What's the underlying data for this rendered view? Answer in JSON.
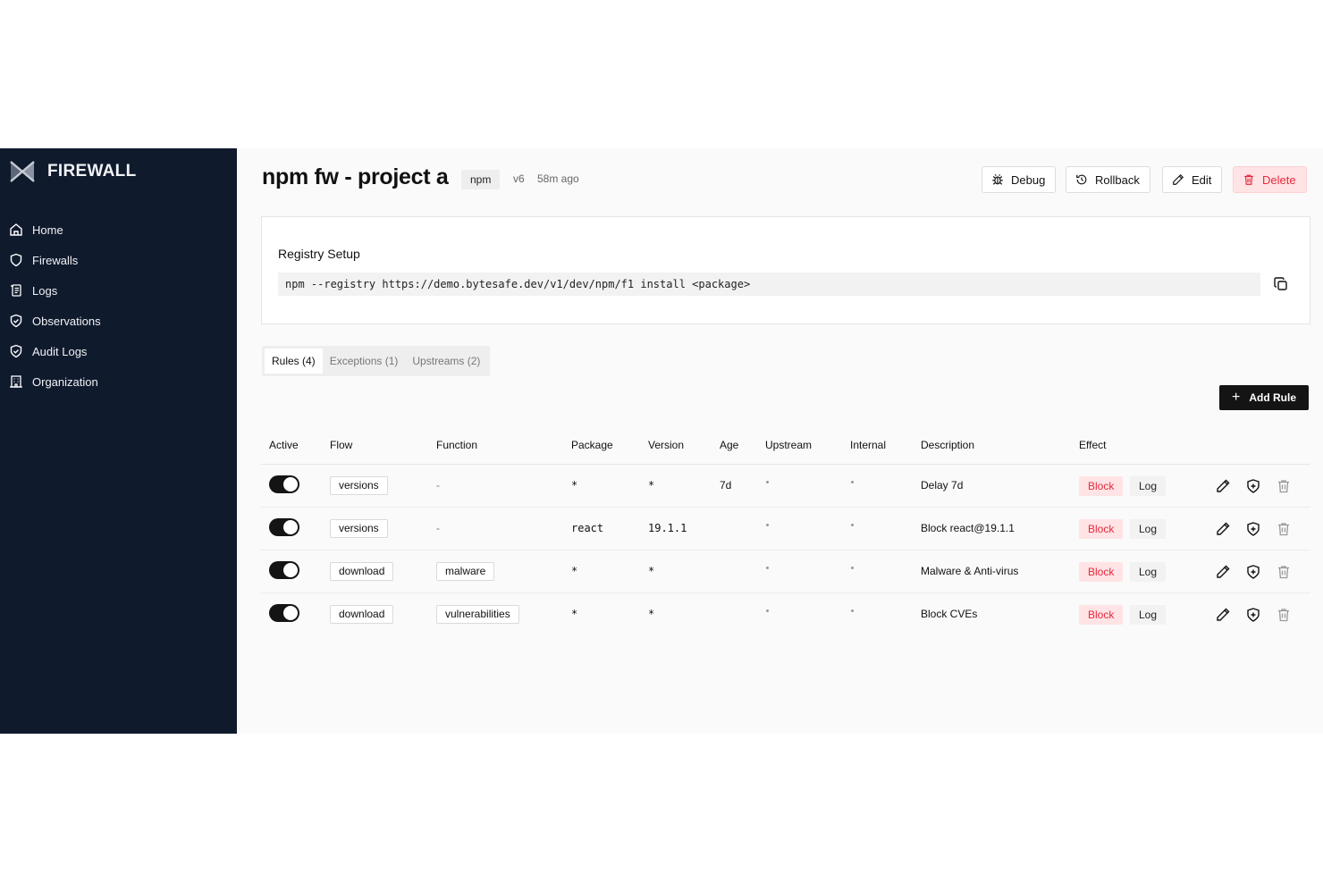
{
  "sidebar": {
    "brand": "FIREWALL",
    "items": [
      {
        "label": "Home",
        "icon": "home-icon"
      },
      {
        "label": "Firewalls",
        "icon": "shield-icon"
      },
      {
        "label": "Logs",
        "icon": "scroll-icon"
      },
      {
        "label": "Observations",
        "icon": "shield-check-icon"
      },
      {
        "label": "Audit Logs",
        "icon": "shield-check-icon"
      },
      {
        "label": "Organization",
        "icon": "building-icon"
      }
    ]
  },
  "header": {
    "title": "npm fw - project a",
    "type_tag": "npm",
    "version": "v6",
    "updated": "58m ago",
    "actions": {
      "debug": "Debug",
      "rollback": "Rollback",
      "edit": "Edit",
      "delete": "Delete"
    }
  },
  "registry": {
    "title": "Registry Setup",
    "command": "npm --registry https://demo.bytesafe.dev/v1/dev/npm/f1 install <package>"
  },
  "tabs": [
    {
      "label": "Rules (4)",
      "active": true
    },
    {
      "label": "Exceptions (1)",
      "active": false
    },
    {
      "label": "Upstreams (2)",
      "active": false
    }
  ],
  "add_rule_label": "Add Rule",
  "table": {
    "columns": [
      "Active",
      "Flow",
      "Function",
      "Package",
      "Version",
      "Age",
      "Upstream",
      "Internal",
      "Description",
      "Effect"
    ],
    "rows": [
      {
        "active": true,
        "flow": "versions",
        "function": "-",
        "package": "*",
        "version": "*",
        "age": "7d",
        "description": "Delay 7d",
        "effect_block": "Block",
        "effect_log": "Log"
      },
      {
        "active": true,
        "flow": "versions",
        "function": "-",
        "package": "react",
        "version": "19.1.1",
        "age": "",
        "description": "Block react@19.1.1",
        "effect_block": "Block",
        "effect_log": "Log"
      },
      {
        "active": true,
        "flow": "download",
        "function": "malware",
        "package": "*",
        "version": "*",
        "age": "",
        "description": "Malware & Anti-virus",
        "effect_block": "Block",
        "effect_log": "Log"
      },
      {
        "active": true,
        "flow": "download",
        "function": "vulnerabilities",
        "package": "*",
        "version": "*",
        "age": "",
        "description": "Block CVEs",
        "effect_block": "Block",
        "effect_log": "Log"
      }
    ]
  },
  "colors": {
    "sidebar_bg": "#0f1a2d",
    "danger": "#e5293c",
    "danger_bg": "#ffe3e5",
    "primary_button": "#141414"
  }
}
